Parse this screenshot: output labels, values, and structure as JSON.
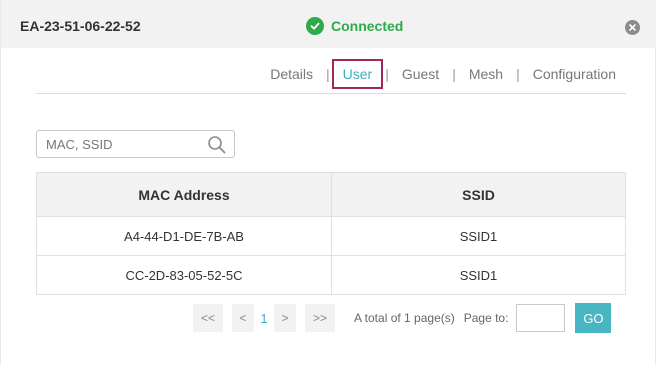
{
  "header": {
    "device_name": "EA-23-51-06-22-52",
    "status": "Connected",
    "status_icon": "check-circle-icon",
    "close_icon": "close-icon",
    "status_color": "#2eaa4a"
  },
  "tabs": [
    {
      "label": "Details",
      "active": false
    },
    {
      "label": "User",
      "active": true
    },
    {
      "label": "Guest",
      "active": false
    },
    {
      "label": "Mesh",
      "active": false
    },
    {
      "label": "Configuration",
      "active": false
    }
  ],
  "tab_separator": "|",
  "search": {
    "placeholder": "MAC, SSID",
    "value": "",
    "icon": "search-icon"
  },
  "table": {
    "columns": [
      "MAC Address",
      "SSID"
    ],
    "rows": [
      [
        "A4-44-D1-DE-7B-AB",
        "SSID1"
      ],
      [
        "CC-2D-83-05-52-5C",
        "SSID1"
      ]
    ]
  },
  "pagination": {
    "first": "<<",
    "prev": "<",
    "current_page": "1",
    "next": ">",
    "last": ">>",
    "summary": "A total of 1 page(s)",
    "page_to_label": "Page to:",
    "page_to_value": "",
    "go_label": "GO"
  },
  "colors": {
    "accent": "#48b6c2",
    "active_tab_outline": "#a0275a"
  }
}
